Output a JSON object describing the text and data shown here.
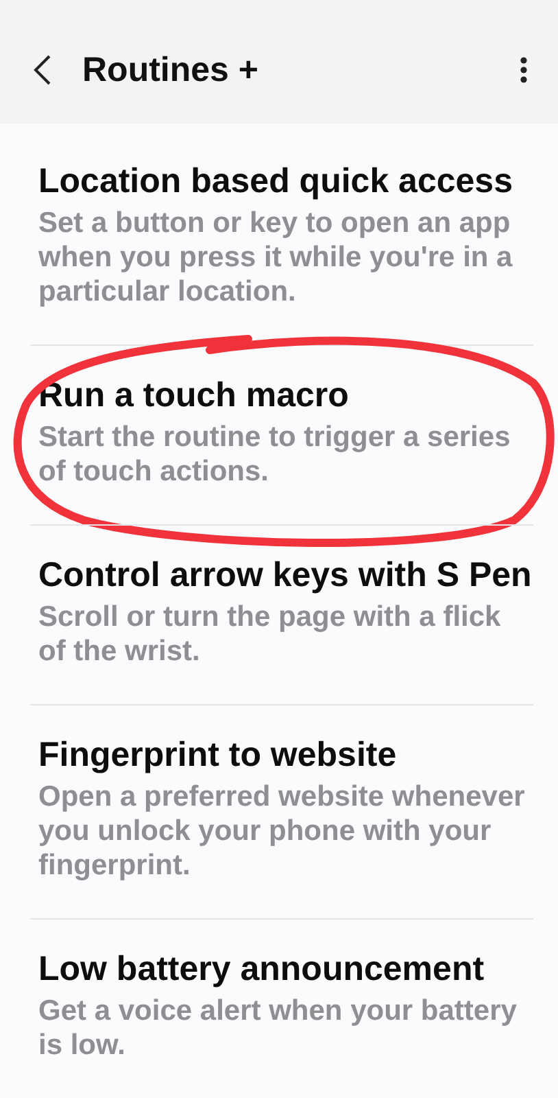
{
  "header": {
    "title": "Routines +"
  },
  "items": [
    {
      "title": "Location based quick access",
      "description": "Set a button or key to open an app when you press it while you're in a particular location.",
      "circled": false
    },
    {
      "title": "Run a touch macro",
      "description": "Start the routine to trigger a series of touch actions.",
      "circled": true
    },
    {
      "title": "Control arrow keys with S Pen",
      "description": "Scroll or turn the page with a flick of the wrist.",
      "circled": false
    },
    {
      "title": "Fingerprint to website",
      "description": "Open a preferred website whenever you unlock your phone with your fingerprint.",
      "circled": false
    },
    {
      "title": "Low battery announcement",
      "description": "Get a voice alert when your battery is low.",
      "circled": false
    }
  ]
}
